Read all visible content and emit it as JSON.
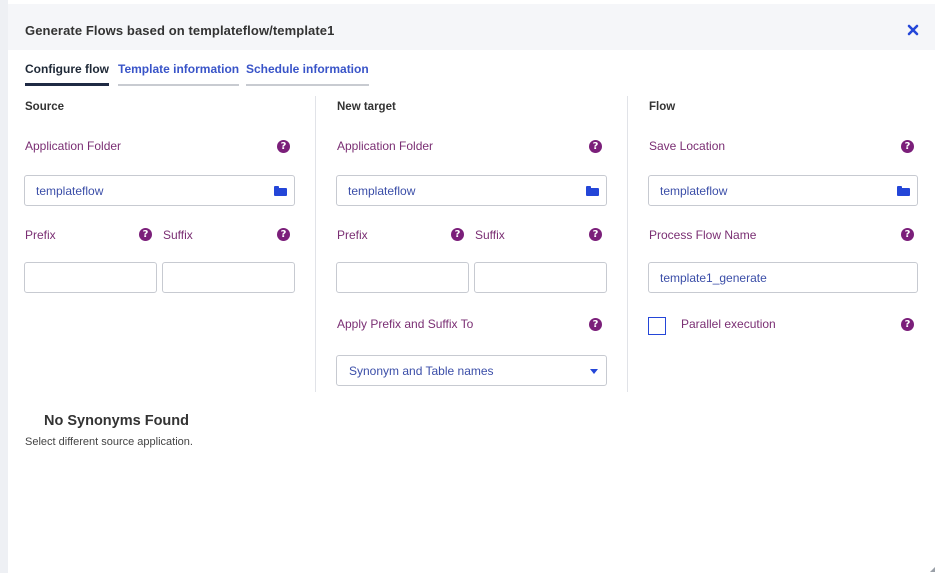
{
  "dialog": {
    "title": "Generate Flows based on templateflow/template1",
    "close_icon": "close-icon"
  },
  "tabs": [
    {
      "label": "Configure flow",
      "active": true
    },
    {
      "label": "Template information",
      "active": false
    },
    {
      "label": "Schedule information",
      "active": false
    }
  ],
  "source": {
    "heading": "Source",
    "app_folder_label": "Application Folder",
    "app_folder_value": "templateflow",
    "prefix_label": "Prefix",
    "suffix_label": "Suffix",
    "prefix_value": "",
    "suffix_value": ""
  },
  "target": {
    "heading": "New target",
    "app_folder_label": "Application Folder",
    "app_folder_value": "templateflow",
    "prefix_label": "Prefix",
    "suffix_label": "Suffix",
    "prefix_value": "",
    "suffix_value": "",
    "apply_label": "Apply Prefix and Suffix To",
    "apply_selected": "Synonym and Table names"
  },
  "flow": {
    "heading": "Flow",
    "save_location_label": "Save Location",
    "save_location_value": "templateflow",
    "name_label": "Process Flow Name",
    "name_value": "template1_generate",
    "parallel_label": "Parallel execution",
    "parallel_checked": false
  },
  "empty_state": {
    "title": "No Synonyms Found",
    "subtitle": "Select different source application."
  },
  "help_glyph": "?",
  "colors": {
    "accent": "#2446d8",
    "label": "#7a2e73",
    "help": "#7b1f7a",
    "tab_link": "#3954c8"
  }
}
